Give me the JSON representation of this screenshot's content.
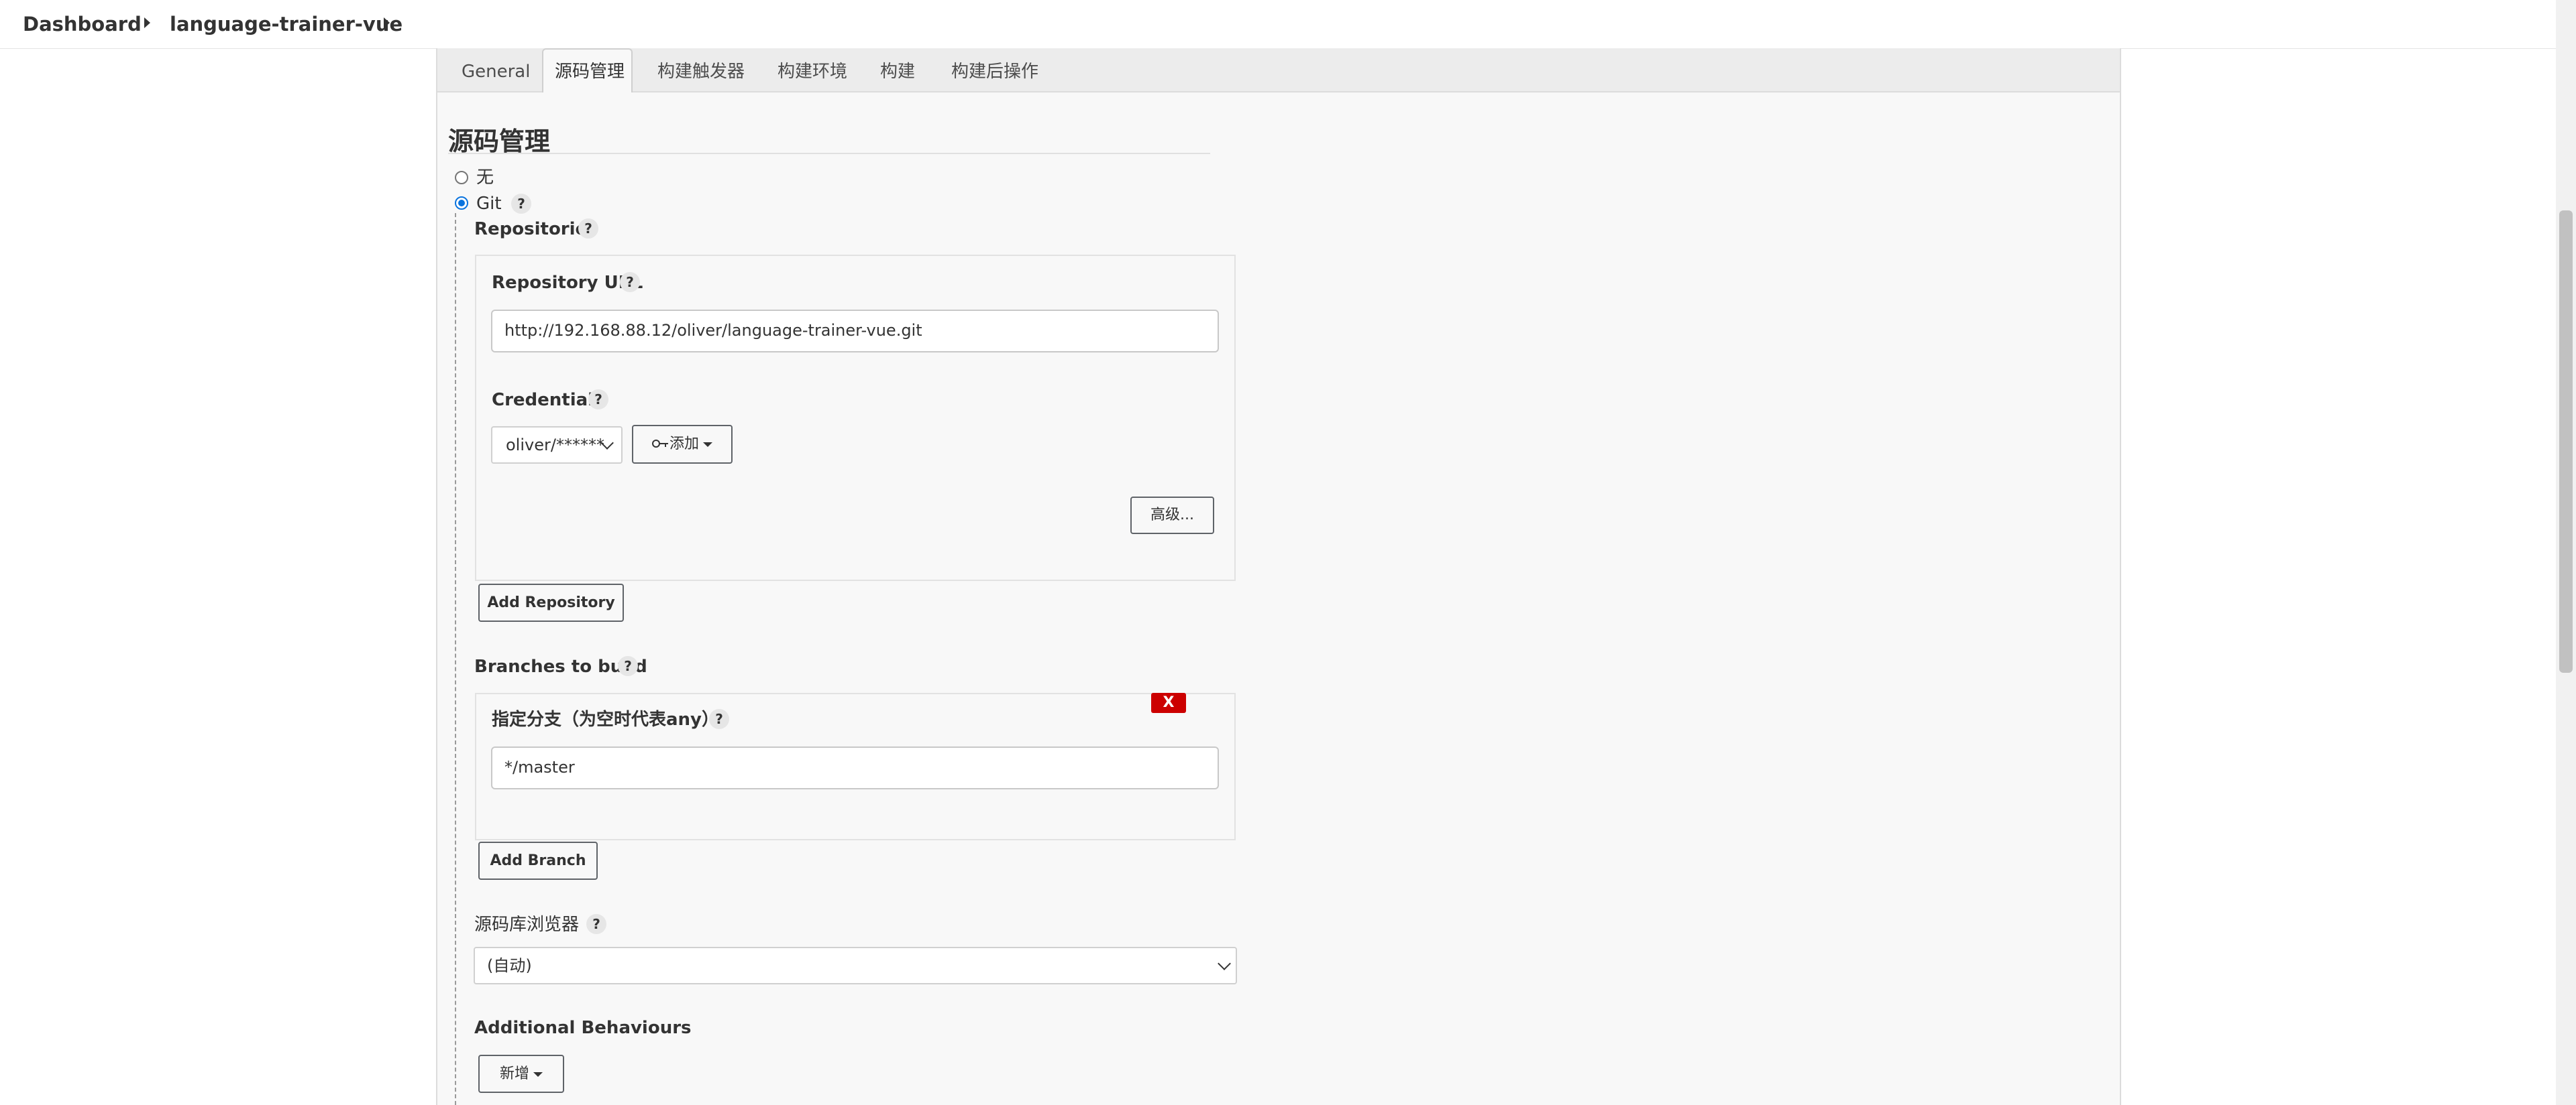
{
  "breadcrumb": {
    "items": [
      "Dashboard",
      "language-trainer-vue"
    ]
  },
  "tabs": [
    {
      "label": "General",
      "active": false
    },
    {
      "label": "源码管理",
      "active": true
    },
    {
      "label": "构建触发器",
      "active": false
    },
    {
      "label": "构建环境",
      "active": false
    },
    {
      "label": "构建",
      "active": false
    },
    {
      "label": "构建后操作",
      "active": false
    }
  ],
  "scm": {
    "section_title": "源码管理",
    "options": [
      {
        "label": "无",
        "selected": false
      },
      {
        "label": "Git",
        "selected": true
      }
    ],
    "help_symbol": "?",
    "repositories_label": "Repositories",
    "repository": {
      "url_label": "Repository URL",
      "url_value": "http://192.168.88.12/oliver/language-trainer-vue.git",
      "credentials_label": "Credentials",
      "credentials_value": "oliver/******",
      "add_button": "添加",
      "advanced_button": "高级..."
    },
    "add_repository_button": "Add Repository",
    "branches_label": "Branches to build",
    "branch": {
      "delete_label": "X",
      "specifier_label": "指定分支（为空时代表any）",
      "specifier_value": "*/master"
    },
    "add_branch_button": "Add Branch",
    "browser_label": "源码库浏览器",
    "browser_value": "(自动)",
    "additional_behaviours_label": "Additional Behaviours",
    "add_behaviour_button": "新增"
  },
  "colors": {
    "accent": "#0b74de",
    "danger": "#cc0000",
    "panel_bg": "#f8f8f8"
  }
}
